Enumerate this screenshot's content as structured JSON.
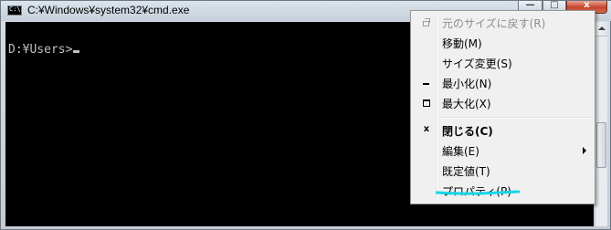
{
  "window": {
    "title": "C:¥Windows¥system32¥cmd.exe",
    "icon": "console-icon",
    "controls": {
      "minimize": "—",
      "maximize": "□",
      "close": "x"
    }
  },
  "console": {
    "prompt": "D:¥Users>",
    "text_color": "#c0c0c0",
    "background": "#000000"
  },
  "menu": {
    "items": [
      {
        "label": "元のサイズに戻す(R)",
        "icon": "restore-icon",
        "disabled": true
      },
      {
        "label": "移動(M)",
        "icon": "",
        "disabled": false
      },
      {
        "label": "サイズ変更(S)",
        "icon": "",
        "disabled": false
      },
      {
        "label": "最小化(N)",
        "icon": "minimize-icon",
        "disabled": false
      },
      {
        "label": "最大化(X)",
        "icon": "maximize-icon",
        "disabled": false
      },
      {
        "label": "閉じる(C)",
        "icon": "close-icon",
        "glyph": "x",
        "bold": true
      },
      {
        "label": "編集(E)",
        "icon": "",
        "submenu": true
      },
      {
        "label": "既定値(T)",
        "icon": ""
      },
      {
        "label": "プロパティ(P)",
        "icon": "",
        "highlighted_with_stroke": true
      }
    ]
  },
  "annotation": {
    "stroke_color": "#19d6e8"
  }
}
